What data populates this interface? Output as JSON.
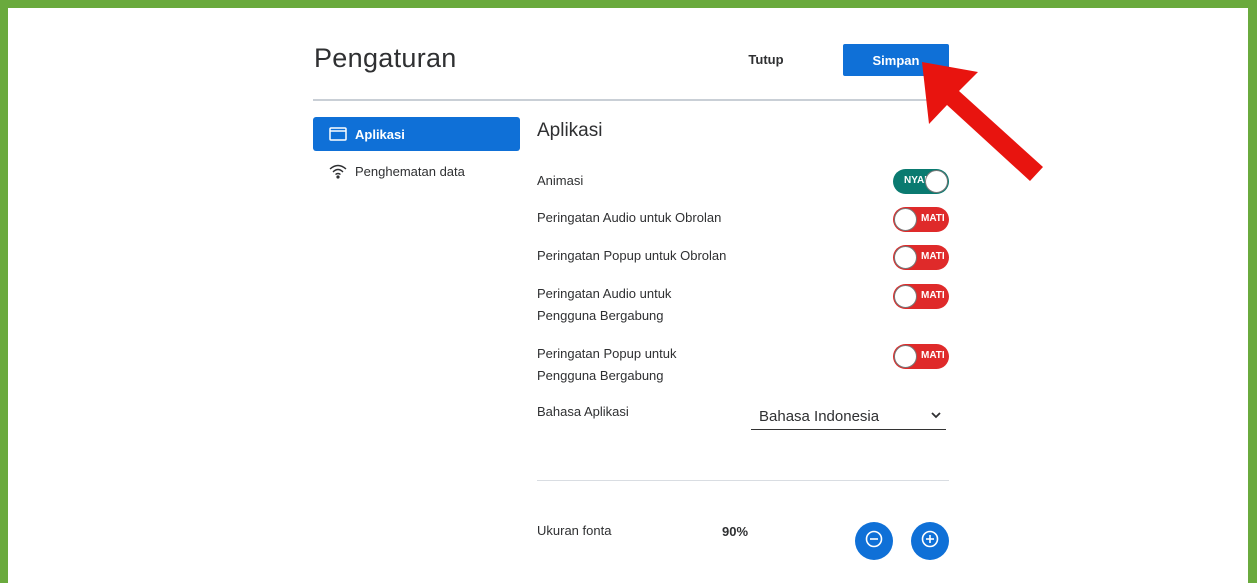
{
  "header": {
    "title": "Pengaturan",
    "close_label": "Tutup",
    "save_label": "Simpan"
  },
  "sidebar": {
    "items": [
      {
        "label": "Aplikasi",
        "icon": "window-icon",
        "active": true
      },
      {
        "label": "Penghematan data",
        "icon": "wifi-icon",
        "active": false
      }
    ]
  },
  "main": {
    "section_title": "Aplikasi",
    "settings": [
      {
        "label": "Animasi",
        "state": "NYALA",
        "on": true
      },
      {
        "label": "Peringatan Audio untuk Obrolan",
        "state": "MATI",
        "on": false
      },
      {
        "label": "Peringatan Popup untuk Obrolan",
        "state": "MATI",
        "on": false
      },
      {
        "label_line1": "Peringatan Audio untuk",
        "label_line2": "Pengguna Bergabung",
        "state": "MATI",
        "on": false
      },
      {
        "label_line1": "Peringatan Popup untuk",
        "label_line2": "Pengguna Bergabung",
        "state": "MATI",
        "on": false
      }
    ],
    "language": {
      "label": "Bahasa Aplikasi",
      "value": "Bahasa Indonesia"
    },
    "font_size": {
      "label": "Ukuran fonta",
      "value": "90%"
    }
  },
  "colors": {
    "accent": "#0f70d7",
    "toggle_on": "#0a7a70",
    "toggle_off": "#df2a2a",
    "frame": "#6aaa3d",
    "annotation_arrow": "#e8140f"
  }
}
